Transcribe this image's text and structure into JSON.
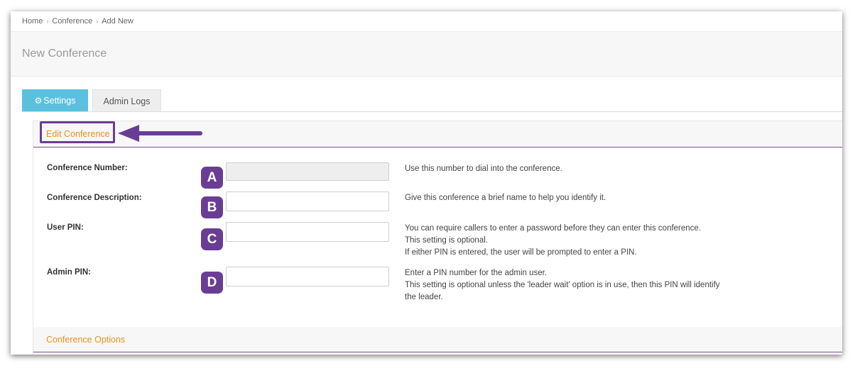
{
  "breadcrumb": {
    "items": [
      "Home",
      "Conference",
      "Add New"
    ],
    "separator": "›"
  },
  "page": {
    "title": "New Conference"
  },
  "tabs": [
    {
      "label": "Settings",
      "icon": "gear-icon",
      "active": true
    },
    {
      "label": "Admin Logs",
      "active": false
    }
  ],
  "edit_section": {
    "title": "Edit Conference"
  },
  "fields": [
    {
      "label": "Conference Number:",
      "badge": "A",
      "value": "",
      "placeholder": "",
      "disabled": true,
      "help": [
        "Use this number to dial into the conference."
      ]
    },
    {
      "label": "Conference Description:",
      "badge": "B",
      "value": "",
      "placeholder": "",
      "disabled": false,
      "help": [
        "Give this conference a brief name to help you identify it."
      ]
    },
    {
      "label": "User PIN:",
      "badge": "C",
      "value": "",
      "placeholder": "",
      "disabled": false,
      "help": [
        "You can require callers to enter a password before they can enter this conference.",
        "This setting is optional.",
        "If either PIN is entered, the user will be prompted to enter a PIN."
      ]
    },
    {
      "label": "Admin PIN:",
      "badge": "D",
      "value": "",
      "placeholder": "",
      "disabled": false,
      "help": [
        "Enter a PIN number for the admin user.",
        "This setting is optional unless the 'leader wait' option is in use, then this PIN will identify",
        "the leader."
      ]
    }
  ],
  "options_section": {
    "title": "Conference Options"
  },
  "colors": {
    "accent_orange": "#e6921e",
    "tab_active": "#5bc0de",
    "annotation_purple": "#6a3d94"
  }
}
